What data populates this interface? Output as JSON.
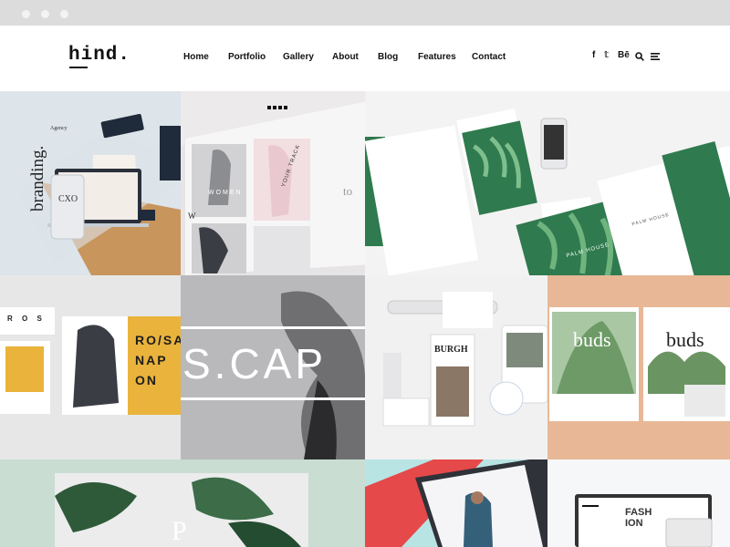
{
  "window": {
    "dots": [
      "",
      "",
      ""
    ]
  },
  "header": {
    "logo": "hind.",
    "nav": [
      "Home",
      "Portfolio",
      "Gallery",
      "About",
      "Blog",
      "Features",
      "Contact"
    ],
    "social": {
      "facebook": "f",
      "twitter": "𝕥",
      "behance": "Bē"
    }
  },
  "tiles": {
    "branding": {
      "vertical": "branding.",
      "agency": "Agency",
      "logo": "CXO"
    },
    "fashion": {
      "women": "WOMEN",
      "track": "YOUR TRACK",
      "letter_w": "W",
      "side": "to"
    },
    "palm": {
      "card": "PALM HOUSE",
      "note": "PALM HOUSE"
    },
    "posters": {
      "ros": "R O S",
      "san": "RO/SAL NAP ON"
    },
    "scap": {
      "text": "S.CAP"
    },
    "burgh": {
      "title": "BURGH"
    },
    "buds": {
      "left": "buds",
      "right": "buds"
    },
    "leaves": {
      "letter": "P"
    },
    "fashion_site": {
      "text": "FASH ION"
    }
  },
  "colors": {
    "chrome": "#dcdcdc",
    "peach": "#e8b896",
    "mint": "#c9ddd2",
    "cyan": "#b8e4e4",
    "green_leaf": "#2f7a4e",
    "coral": "#e6494a"
  }
}
